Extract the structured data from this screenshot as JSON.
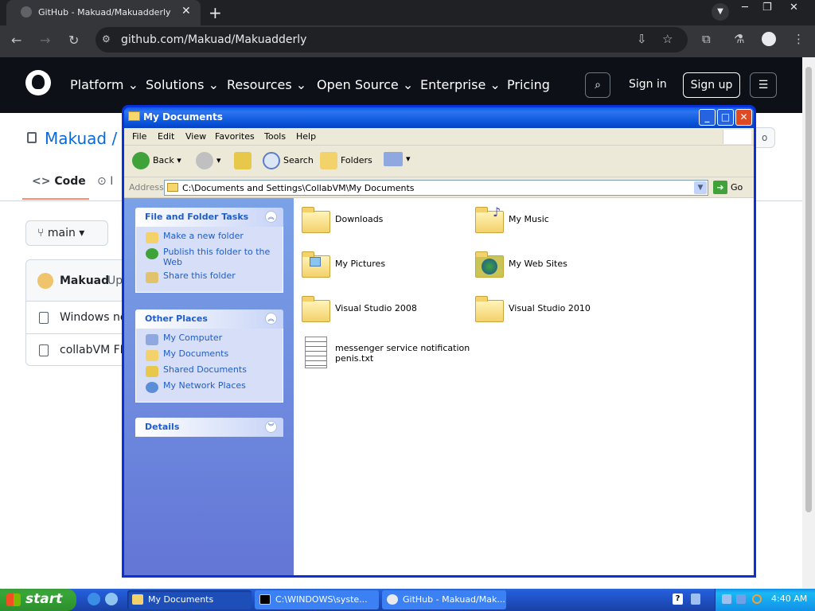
{
  "browser": {
    "tab_title": "GitHub - Makuad/Makuadderly",
    "url": "github.com/Makuad/Makuadderly"
  },
  "github": {
    "nav": [
      "Platform",
      "Solutions",
      "Resources",
      "Open Source",
      "Enterprise",
      "Pricing"
    ],
    "sign_in": "Sign in",
    "sign_up": "Sign up",
    "repo_title": "Makuad / M",
    "code_tab": "Code",
    "issues_tab": "I",
    "branch": "main",
    "commit_author": "Makuad",
    "commit_msg": "Up",
    "files": [
      "Windows not",
      "collabVM FIX"
    ]
  },
  "explorer": {
    "title": "My Documents",
    "menu": [
      "File",
      "Edit",
      "View",
      "Favorites",
      "Tools",
      "Help"
    ],
    "toolbar": {
      "back": "Back",
      "search": "Search",
      "folders": "Folders"
    },
    "address_label": "Address",
    "address": "C:\\Documents and Settings\\CollabVM\\My Documents",
    "go": "Go",
    "tasks_title": "File and Folder Tasks",
    "tasks": [
      "Make a new folder",
      "Publish this folder to the Web",
      "Share this folder"
    ],
    "places_title": "Other Places",
    "places": [
      "My Computer",
      "My Documents",
      "Shared Documents",
      "My Network Places"
    ],
    "details_title": "Details",
    "items": [
      {
        "label": "Downloads",
        "icon": "folder-icon"
      },
      {
        "label": "My Music",
        "icon": "music-folder-icon"
      },
      {
        "label": "My Pictures",
        "icon": "pictures-folder-icon"
      },
      {
        "label": "My Web Sites",
        "icon": "web-folder-icon"
      },
      {
        "label": "Visual Studio 2008",
        "icon": "folder-icon"
      },
      {
        "label": "Visual Studio 2010",
        "icon": "folder-icon"
      },
      {
        "label": "messenger service notification penis.txt",
        "icon": "text-file-icon"
      }
    ]
  },
  "taskbar": {
    "start": "start",
    "tasks": [
      "My Documents",
      "C:\\WINDOWS\\syste...",
      "GitHub - Makuad/Mak..."
    ],
    "clock": "4:40 AM"
  }
}
